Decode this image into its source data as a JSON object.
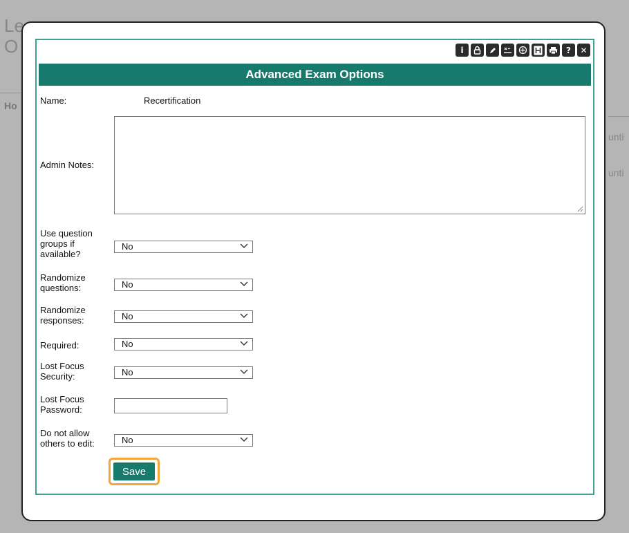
{
  "background": {
    "title_line_1": "Le",
    "title_line_2": "O",
    "tab_text": "Ho",
    "right_text_1": "unti",
    "right_text_2": "unti"
  },
  "toolbar": {
    "icons": [
      "info-icon",
      "lock-icon",
      "edit-icon",
      "signature-icon",
      "move-icon",
      "heading-icon",
      "print-icon",
      "help-icon",
      "close-icon"
    ]
  },
  "dialog": {
    "title": "Advanced Exam Options",
    "name_label": "Name:",
    "name_value": "Recertification",
    "admin_notes_label": "Admin Notes:",
    "admin_notes_value": "",
    "question_groups_label": "Use question groups if available?",
    "question_groups_value": "No",
    "randomize_questions_label": "Randomize questions:",
    "randomize_questions_value": "No",
    "randomize_responses_label": "Randomize responses:",
    "randomize_responses_value": "No",
    "required_label": "Required:",
    "required_value": "No",
    "lost_focus_security_label": "Lost Focus Security:",
    "lost_focus_security_value": "No",
    "lost_focus_password_label": "Lost Focus Password:",
    "lost_focus_password_value": "",
    "no_edit_label": "Do not allow others to edit:",
    "no_edit_value": "No",
    "save_label": "Save"
  },
  "colors": {
    "accent": "#167b6d",
    "panel_border": "#3f9e94",
    "focus_ring": "#f0a63a"
  }
}
